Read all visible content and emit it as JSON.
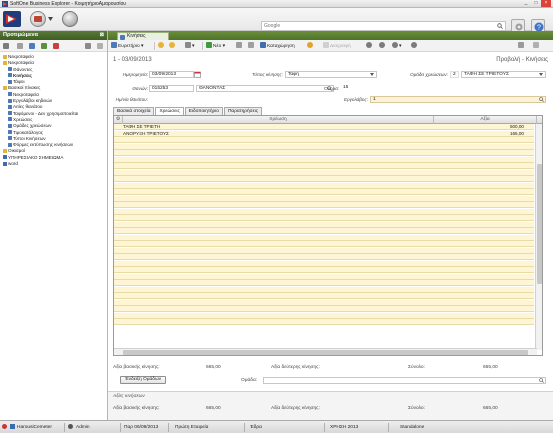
{
  "window": {
    "title": "SoftOne Business Explorer - ΚοιμητήριοΑμαρουσίου",
    "min": "_",
    "max": "□",
    "close": "×"
  },
  "topbar": {
    "search_placeholder": "Google"
  },
  "left_panel": {
    "header": "Προτιμώμενα",
    "pin": "⊠",
    "tree": [
      {
        "label": "Νεκροταφείο",
        "indent": 1,
        "icon": "folder",
        "bold": false
      },
      {
        "label": "Νεκροταφεία",
        "indent": 1,
        "icon": "folder",
        "bold": false
      },
      {
        "label": "Θάνοντες",
        "indent": 2,
        "icon": "list",
        "bold": false
      },
      {
        "label": "Κινήσεις",
        "indent": 2,
        "icon": "list",
        "bold": true
      },
      {
        "label": "Τάφοι",
        "indent": 2,
        "icon": "list",
        "bold": false
      },
      {
        "label": "Βασικοί πίνακες",
        "indent": 1,
        "icon": "folder",
        "bold": false
      },
      {
        "label": "Νεκροταφεία",
        "indent": 2,
        "icon": "list",
        "bold": false
      },
      {
        "label": "Εργολάβοι κηδειών",
        "indent": 2,
        "icon": "list",
        "bold": false
      },
      {
        "label": "Αιτίες θανάτου",
        "indent": 2,
        "icon": "list",
        "bold": false
      },
      {
        "label": "Ταφόμενοι - Δεν χρησιμοποιείται",
        "indent": 2,
        "icon": "list",
        "bold": false
      },
      {
        "label": "Χρεώσεις",
        "indent": 2,
        "icon": "list",
        "bold": false
      },
      {
        "label": "Ομάδες χρεώσεων",
        "indent": 2,
        "icon": "list",
        "bold": false
      },
      {
        "label": "Τιμοκατάλογος",
        "indent": 2,
        "icon": "list",
        "bold": false
      },
      {
        "label": "Τύποι Κινήσεων",
        "indent": 2,
        "icon": "list",
        "bold": false
      },
      {
        "label": "Φόρμες εκτύπωσης κινήσεων",
        "indent": 2,
        "icon": "list",
        "bold": false
      },
      {
        "label": "Οικισμοί",
        "indent": 1,
        "icon": "folder",
        "bold": false
      },
      {
        "label": "ΥΠΗΡΕΣΙΑΚΟ ΣΗΜΕΙΩΜΑ",
        "indent": 1,
        "icon": "doc",
        "bold": false
      },
      {
        "label": "word",
        "indent": 1,
        "icon": "doc",
        "bold": false
      }
    ]
  },
  "doc": {
    "tab_label": "Κινήσεις",
    "toolbar": {
      "search": "Ευρετήριο",
      "new": "Νέο",
      "save": "Καταχώρηση",
      "delete": "Διαγραφή"
    },
    "title": "1 - 03/09/2013",
    "mode": "Προβολή - Κινήσεις",
    "fields": {
      "date_label": "Ημερομηνία:",
      "date_value": "03/09/2013",
      "movement_type_label": "Τύπος κίνησης:",
      "movement_type_value": "Ταφή",
      "charge_group_label": "Ομάδα χρεώσεων:",
      "charge_group_code": "2",
      "charge_group_value": "ΤΑΦΗ ΣΕ ΤΡΙΕΤΟΥΣ",
      "deceased_label": "Θανών:",
      "deceased_code": "015253",
      "deceased_surname": "ΘΑΝΟΝΤΑΣ",
      "name_label": "Όνομα:",
      "name_value": "15",
      "death_date_label": "Ημ/νία θανάτου:",
      "death_date_value": "",
      "contractor_label": "Εργολάβος:",
      "contractor_value": "1"
    },
    "subtabs": [
      "Βασικά στοιχεία",
      "Χρεώσεις",
      "Ειδοποιητήριο",
      "Παρατηρήσεις"
    ],
    "active_subtab": 1,
    "grid": {
      "col_charge": "Χρέωση",
      "col_value": "Αξία",
      "rows": [
        {
          "charge": "ΤΑΦΗ ΣΕ ΤΡΙΕΤΗ",
          "value": "500,00"
        },
        {
          "charge": "ΑΝΟΡΥΞΗ ΤΡΙΕΤΟΥΣ",
          "value": "165,00"
        }
      ]
    },
    "totals": {
      "base_label": "Αξία βασικής κίνησης:",
      "base_value": "665,00",
      "secondary_label": "Αξία δεύτερης κίνησης:",
      "secondary_value": "",
      "sum_label": "Σύνολο:",
      "sum_value": "665,00"
    },
    "group_button": "Ένδειξη Ομάδων",
    "group_label": "Ομάδα:",
    "group_value": "",
    "section_title": "Αξίες κινήσεων",
    "footer_totals": {
      "base_label": "Αξία βασικής κίνησης:",
      "base_value": "665,00",
      "secondary_label": "Αξία δεύτερης κίνησης:",
      "secondary_value": "",
      "sum_label": "Σύνολο:",
      "sum_value": "665,00"
    }
  },
  "statusbar": {
    "company": "HarousiCemeter",
    "user": "Admin",
    "date": "Παρ 06/09/2013",
    "company_label": "Πρώτη Εταιρεία",
    "branch": "Έδρα",
    "year": "ΧΡΗΣΗ 2013",
    "mode": "Standalone"
  },
  "colors": {
    "green_header": "#4d7328",
    "grid_row": "#fdf5d3",
    "status_bg": "#e5e5e5"
  }
}
